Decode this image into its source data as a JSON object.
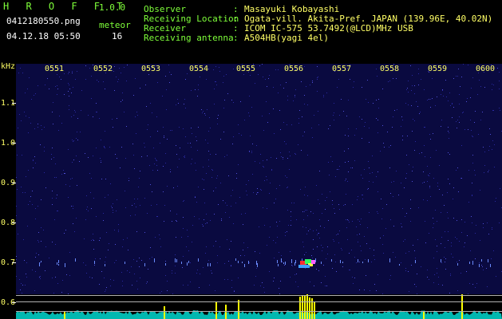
{
  "header": {
    "app_name": "H R O F F T",
    "version": "1.0.0",
    "filename": "0412180550.png",
    "datetime": "04.12.18 05:50",
    "meteor_label": "meteor",
    "meteor_count": "16",
    "fields": [
      {
        "label": "Observer",
        "value": "Masayuki Kobayashi"
      },
      {
        "label": "Receiving Location",
        "value": "Ogata-vill. Akita-Pref. JAPAN (139.96E, 40.02N)"
      },
      {
        "label": "Receiver",
        "value": "ICOM IC-575 53.7492(@LCD)MHz USB"
      },
      {
        "label": "Receiving antenna",
        "value": "A504HB(yagi 4el)"
      }
    ],
    "separator": ":"
  },
  "axis": {
    "unit": "kHz",
    "y_labels": [
      "1.1",
      "1.0",
      "0.9",
      "0.8",
      "0.7",
      "0.6"
    ],
    "time_labels": [
      "0551",
      "0552",
      "0553",
      "0554",
      "0555",
      "0556",
      "0557",
      "0558",
      "0559",
      "0600"
    ]
  },
  "colors": {
    "background": "#000000",
    "spectrogram": "#0a0a40",
    "header_labels": "#7fff3a",
    "header_values": "#ffff66",
    "signal": "#ffff00",
    "noise_trace": "#00e0d0"
  }
}
